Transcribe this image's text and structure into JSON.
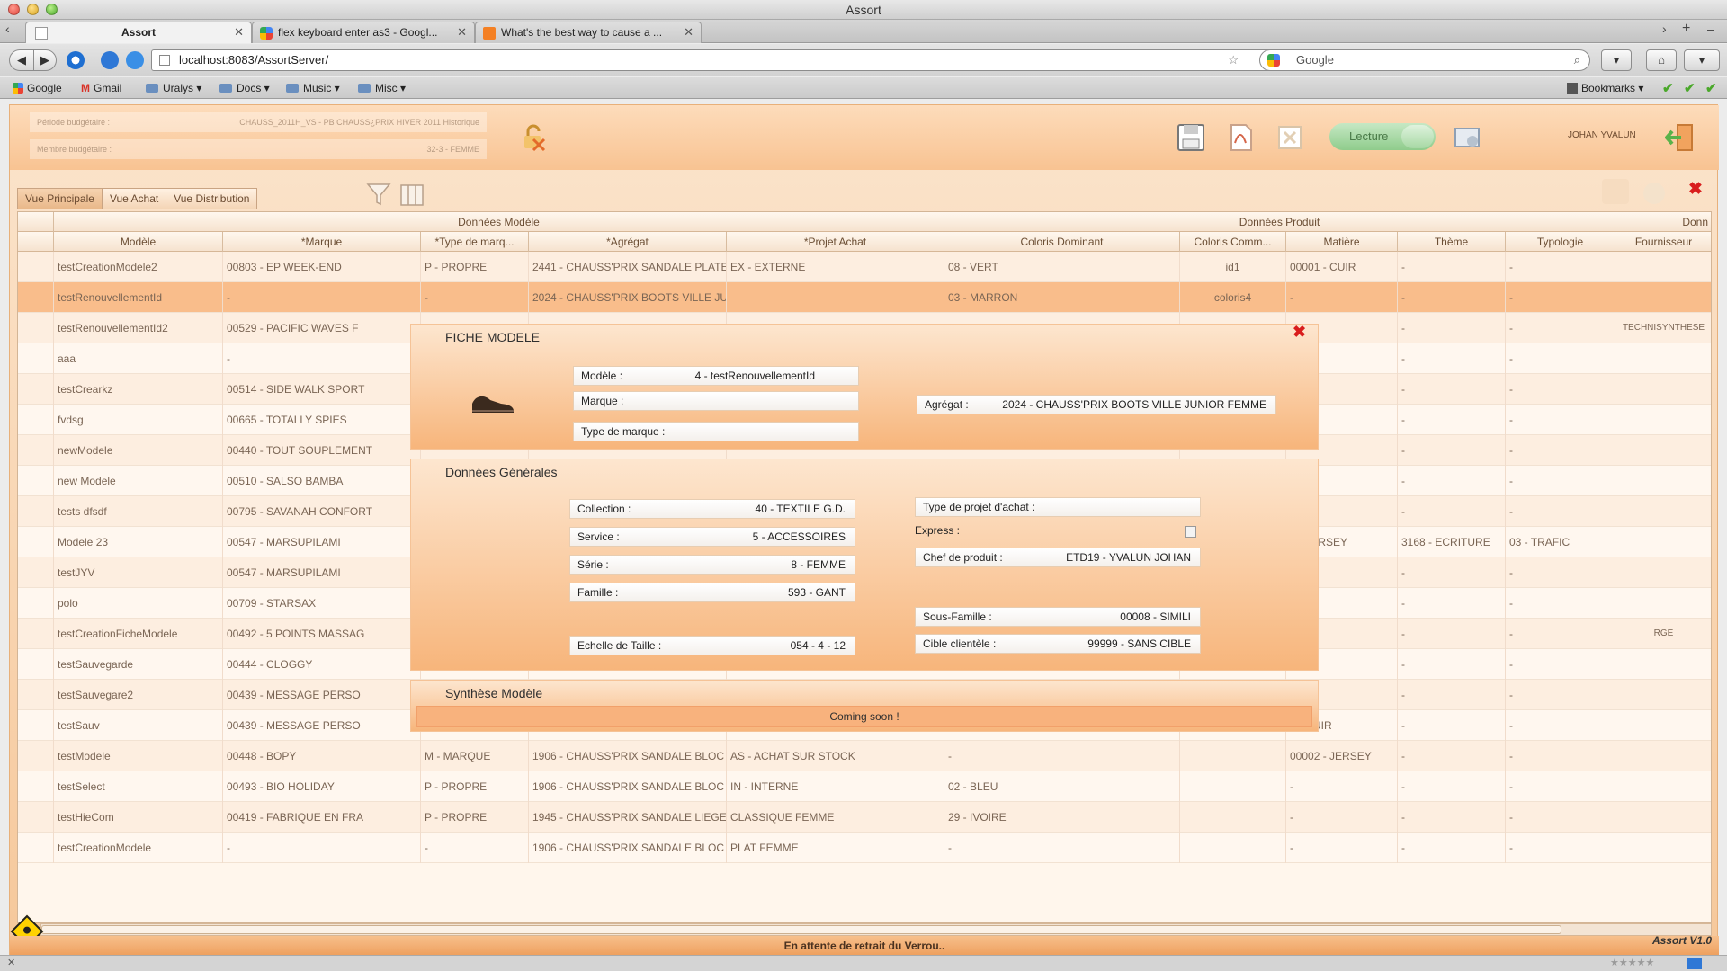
{
  "window": {
    "title": "Assort"
  },
  "tabs": [
    {
      "label": "Assort",
      "active": true
    },
    {
      "label": "flex keyboard enter as3 - Googl...",
      "active": false
    },
    {
      "label": "What's the best way to cause a ...",
      "active": false
    }
  ],
  "nav": {
    "url": "localhost:8083/AssortServer/",
    "search_placeholder": "Google"
  },
  "bookmarks": {
    "items": [
      "Google",
      "Gmail",
      "Uralys",
      "Docs",
      "Music",
      "Misc"
    ],
    "right_label": "Bookmarks"
  },
  "app": {
    "budget_period_label": "Période budgétaire :",
    "budget_period_value": "CHAUSS_2011H_VS - PB CHAUSS¿PRIX HIVER 2011 Historique",
    "budget_member_label": "Membre budgétaire :",
    "budget_member_value": "32-3 - FEMME",
    "mode_toggle": "Lecture",
    "user": "JOHAN YVALUN",
    "views": [
      "Vue Principale",
      "Vue Achat",
      "Vue Distribution"
    ],
    "group_headers": [
      "Données Modèle",
      "Données Produit",
      "Donn"
    ],
    "columns": [
      "Modèle",
      "*Marque",
      "*Type de marq...",
      "*Agrégat",
      "*Projet Achat",
      "Coloris Dominant",
      "Coloris Comm...",
      "Matière",
      "Thème",
      "Typologie",
      "Fournisseur"
    ],
    "rows": [
      [
        "testCreationModele2",
        "00803 - EP WEEK-END",
        "P - PROPRE",
        "2441 - CHAUSS'PRIX SANDALE PLATE EX",
        "EX - EXTERNE",
        "08 - VERT",
        "id1",
        "00001 - CUIR",
        "-",
        "-",
        ""
      ],
      [
        "testRenouvellementId",
        "-",
        "-",
        "2024 - CHAUSS'PRIX BOOTS VILLE JUNIOR FEMME",
        "",
        "03 - MARRON",
        "coloris4",
        "-",
        "-",
        "-",
        ""
      ],
      [
        "testRenouvellementId2",
        "00529 - PACIFIC WAVES F",
        "",
        "",
        "",
        "",
        "",
        "",
        "-",
        "-",
        "TECHNISYNTHESE"
      ],
      [
        "aaa",
        "-",
        "",
        "",
        "",
        "",
        "",
        "",
        "-",
        "-",
        ""
      ],
      [
        "testCrearkz",
        "00514 - SIDE WALK SPORT",
        "",
        "",
        "",
        "",
        "",
        "",
        "-",
        "-",
        ""
      ],
      [
        "fvdsg",
        "00665 - TOTALLY SPIES",
        "",
        "",
        "",
        "",
        "",
        "",
        "-",
        "-",
        ""
      ],
      [
        "newModele",
        "00440 - TOUT SOUPLEMENT",
        "",
        "",
        "",
        "",
        "",
        "",
        "-",
        "-",
        ""
      ],
      [
        "new Modele",
        "00510 - SALSO BAMBA",
        "",
        "",
        "",
        "",
        "",
        "",
        "-",
        "-",
        ""
      ],
      [
        "tests dfsdf",
        "00795 - SAVANAH CONFORT",
        "",
        "",
        "",
        "",
        "",
        "",
        "-",
        "-",
        ""
      ],
      [
        "Modele 23",
        "00547 - MARSUPILAMI",
        "",
        "",
        "",
        "",
        "",
        "2 - JERSEY",
        "3168 - ECRITURE",
        "03 - TRAFIC",
        ""
      ],
      [
        "testJYV",
        "00547 - MARSUPILAMI",
        "",
        "",
        "",
        "",
        "",
        "",
        "-",
        "-",
        ""
      ],
      [
        "polo",
        "00709 - STARSAX",
        "",
        "",
        "",
        "",
        "",
        "",
        "-",
        "-",
        ""
      ],
      [
        "testCreationFicheModele",
        "00492 - 5 POINTS MASSAG",
        "",
        "",
        "",
        "",
        "",
        "",
        "-",
        "-",
        "RGE"
      ],
      [
        "testSauvegarde",
        "00444 - CLOGGY",
        "",
        "",
        "",
        "",
        "",
        "",
        "-",
        "-",
        ""
      ],
      [
        "testSauvegare2",
        "00439 - MESSAGE PERSO",
        "",
        "",
        "",
        "",
        "",
        "",
        "-",
        "-",
        ""
      ],
      [
        "testSauv",
        "00439 - MESSAGE PERSO",
        "",
        "",
        "",
        "",
        "",
        "1 - CUIR",
        "-",
        "-",
        ""
      ],
      [
        "testModele",
        "00448 - BOPY",
        "M - MARQUE",
        "1906 - CHAUSS'PRIX SANDALE BLOC",
        "AS - ACHAT SUR STOCK",
        "-",
        "",
        "00002 - JERSEY",
        "-",
        "-",
        ""
      ],
      [
        "testSelect",
        "00493 - BIO HOLIDAY",
        "P - PROPRE",
        "1906 - CHAUSS'PRIX SANDALE BLOC",
        "IN - INTERNE",
        "02 - BLEU",
        "",
        "-",
        "-",
        "-",
        ""
      ],
      [
        "testHieCom",
        "00419 - FABRIQUE EN FRA",
        "P - PROPRE",
        "1945 - CHAUSS'PRIX SANDALE LIEGE",
        "CLASSIQUE FEMME",
        "29 - IVOIRE",
        "",
        "-",
        "-",
        "-",
        ""
      ],
      [
        "testCreationModele",
        "-",
        "-",
        "1906 - CHAUSS'PRIX SANDALE BLOC",
        "PLAT FEMME",
        "-",
        "",
        "-",
        "-",
        "-",
        ""
      ]
    ],
    "status": "En attente de retrait du Verrou..",
    "version": "Assort V1.0"
  },
  "modal": {
    "fiche": {
      "title": "FICHE MODELE",
      "modele_label": "Modèle :",
      "modele_value": "4 - testRenouvellementId",
      "marque_label": "Marque :",
      "type_marque_label": "Type de marque :",
      "agregat_label": "Agrégat :",
      "agregat_value": "2024 - CHAUSS'PRIX BOOTS VILLE JUNIOR FEMME"
    },
    "general": {
      "title": "Données Générales",
      "collection_label": "Collection :",
      "collection_value": "40 - TEXTILE G.D.",
      "service_label": "Service :",
      "service_value": "5 - ACCESSOIRES",
      "serie_label": "Série :",
      "serie_value": "8 - FEMME",
      "famille_label": "Famille :",
      "famille_value": "593 - GANT",
      "echelle_label": "Echelle de Taille :",
      "echelle_value": "054 - 4 - 12",
      "type_projet_label": "Type de projet d'achat :",
      "express_label": "Express :",
      "chef_label": "Chef de produit :",
      "chef_value": "ETD19 - YVALUN JOHAN",
      "sous_famille_label": "Sous-Famille :",
      "sous_famille_value": "00008 - SIMILI",
      "cible_label": "Cible clientèle :",
      "cible_value": "99999 - SANS CIBLE"
    },
    "synthese": {
      "title": "Synthèse Modèle",
      "coming": "Coming soon !"
    }
  },
  "colors": {
    "accent_orange": "#f7b57b",
    "selected_row": "#f9bd8b",
    "close_red": "#d91d1d"
  }
}
